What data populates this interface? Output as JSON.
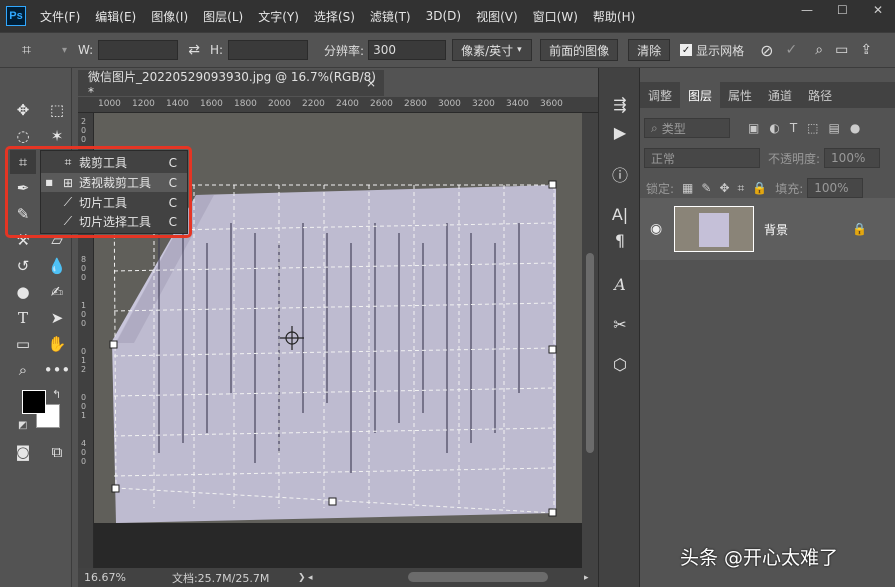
{
  "menubar": {
    "logo": "Ps",
    "items": [
      "文件(F)",
      "编辑(E)",
      "图像(I)",
      "图层(L)",
      "文字(Y)",
      "选择(S)",
      "滤镜(T)",
      "3D(D)",
      "视图(V)",
      "窗口(W)",
      "帮助(H)"
    ]
  },
  "options": {
    "w_label": "W:",
    "h_label": "H:",
    "resolution_label": "分辨率:",
    "resolution_value": "300",
    "unit": "像素/英寸",
    "front_image": "前面的图像",
    "clear": "清除",
    "show_grid": "显示网格"
  },
  "document": {
    "tab_title": "微信图片_20220529093930.jpg @ 16.7%(RGB/8) *",
    "close": "×",
    "ruler_ticks": [
      "1000",
      "1200",
      "1400",
      "1600",
      "1800",
      "2000",
      "2200",
      "2400",
      "2600",
      "2800",
      "3000",
      "3200",
      "3400",
      "3600"
    ],
    "ruler_v_ticks": [
      "2",
      "0",
      "0",
      "4",
      "0",
      "0",
      "6",
      "0",
      "0",
      "8",
      "0",
      "0",
      "1",
      "0",
      "0",
      "0",
      "1",
      "2",
      "0",
      "0",
      "1",
      "4",
      "0",
      "0"
    ]
  },
  "flyout": {
    "items": [
      {
        "label": "裁剪工具",
        "key": "C",
        "icon": "crop-icon"
      },
      {
        "label": "透视裁剪工具",
        "key": "C",
        "icon": "perspective-crop-icon"
      },
      {
        "label": "切片工具",
        "key": "C",
        "icon": "slice-icon"
      },
      {
        "label": "切片选择工具",
        "key": "C",
        "icon": "slice-select-icon"
      }
    ]
  },
  "status": {
    "zoom": "16.67%",
    "doc_size": "文档:25.7M/25.7M"
  },
  "panel": {
    "tabs": [
      "调整",
      "图层",
      "属性",
      "通道",
      "路径"
    ],
    "active_tab": "图层",
    "filter_kind": "类型",
    "blend_mode": "正常",
    "opacity_label": "不透明度:",
    "opacity_value": "100%",
    "lock_label": "锁定:",
    "fill_label": "填充:",
    "fill_value": "100%",
    "layer_name": "背景"
  },
  "watermark": "头条 @开心太难了",
  "colors": {
    "accent_red": "#e53524",
    "ps_blue": "#31a8ff",
    "paper": "#c9c6dc"
  }
}
